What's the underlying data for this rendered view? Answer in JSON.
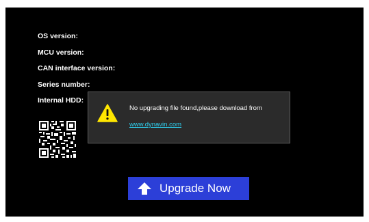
{
  "device_info": {
    "os_version_label": "OS version:",
    "mcu_version_label": "MCU version:",
    "can_interface_version_label": "CAN interface version:",
    "series_number_label": "Series number:",
    "internal_hdd_label": "Internal HDD:"
  },
  "dialog": {
    "icon": "warning-icon",
    "message": "No upgrading file found,please download from",
    "link_text": "www.dynavin.com",
    "link_color": "#2fd0f0"
  },
  "upgrade_button": {
    "label": "Upgrade Now",
    "icon": "upload-arrow-icon",
    "color": "#2c3fd8"
  },
  "colors": {
    "screen_background": "#000000",
    "dialog_background": "#2b2b2b",
    "warning_yellow": "#ffe600"
  }
}
